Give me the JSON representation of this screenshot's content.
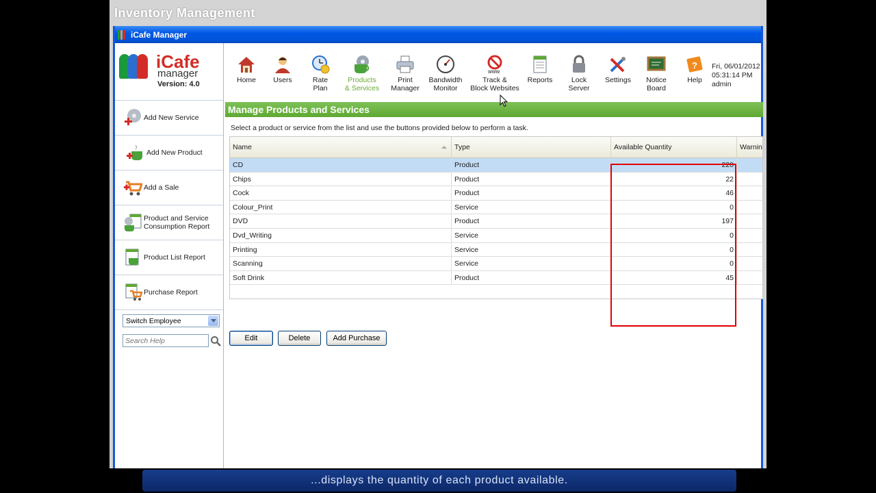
{
  "video": {
    "title": "Inventory Management",
    "caption": "...displays the quantity of each product available."
  },
  "window": {
    "title": "iCafe Manager"
  },
  "logo": {
    "brand": "iCafe",
    "sub": "manager",
    "version": "Version: 4.0"
  },
  "toolbar": {
    "items": [
      {
        "label": "Home",
        "icon": "house-icon"
      },
      {
        "label": "Users",
        "icon": "user-icon"
      },
      {
        "label": "Rate\nPlan",
        "icon": "clock-coin-icon"
      },
      {
        "label": "Products\n& Services",
        "icon": "cup-disc-icon",
        "active": true
      },
      {
        "label": "Print\nManager",
        "icon": "printer-icon"
      },
      {
        "label": "Bandwidth\nMonitor",
        "icon": "gauge-icon"
      },
      {
        "label": "Track &\nBlock Websites",
        "icon": "www-block-icon"
      },
      {
        "label": "Reports",
        "icon": "report-icon"
      },
      {
        "label": "Lock\nServer",
        "icon": "padlock-icon"
      },
      {
        "label": "Settings",
        "icon": "tools-icon"
      },
      {
        "label": "Notice\nBoard",
        "icon": "notice-board-icon"
      },
      {
        "label": "Help",
        "icon": "help-book-icon"
      }
    ],
    "date": "Fri, 06/01/2012",
    "time": "05:31:14 PM",
    "user": "admin"
  },
  "sidebar": {
    "items": [
      {
        "label": "Add New Service",
        "icon": "add-service-icon"
      },
      {
        "label": "Add New Product",
        "icon": "add-product-icon"
      },
      {
        "label": "Add a Sale",
        "icon": "cart-icon"
      },
      {
        "label": "Product and Service\nConsumption Report",
        "icon": "consumption-report-icon"
      },
      {
        "label": "Product List Report",
        "icon": "product-list-report-icon"
      },
      {
        "label": "Purchase Report",
        "icon": "purchase-report-icon"
      }
    ],
    "switch_employee": "Switch Employee",
    "search_placeholder": "Search Help"
  },
  "main": {
    "title": "Manage Products and Services",
    "instruction": "Select a product or service from the list and use the buttons provided below to perform a task.",
    "columns": [
      "Name",
      "Type",
      "Available Quantity",
      "Warnin"
    ],
    "rows": [
      {
        "name": "CD",
        "type": "Product",
        "qty": "220",
        "warn": ""
      },
      {
        "name": "Chips",
        "type": "Product",
        "qty": "22",
        "warn": ""
      },
      {
        "name": "Cock",
        "type": "Product",
        "qty": "46",
        "warn": ""
      },
      {
        "name": "Colour_Print",
        "type": "Service",
        "qty": "0",
        "warn": ""
      },
      {
        "name": "DVD",
        "type": "Product",
        "qty": "197",
        "warn": ""
      },
      {
        "name": "Dvd_Writing",
        "type": "Service",
        "qty": "0",
        "warn": ""
      },
      {
        "name": "Printing",
        "type": "Service",
        "qty": "0",
        "warn": ""
      },
      {
        "name": "Scanning",
        "type": "Service",
        "qty": "0",
        "warn": ""
      },
      {
        "name": "Soft Drink",
        "type": "Product",
        "qty": "45",
        "warn": ""
      }
    ],
    "selected_row": 0,
    "buttons": {
      "edit": "Edit",
      "delete": "Delete",
      "add_purchase": "Add Purchase"
    }
  },
  "colors": {
    "titlebar": "#0058e6",
    "header_green": "#6ab23e",
    "selection": "#c3dcf6",
    "highlight_box": "#e00000",
    "caption_bg": "#14367d"
  }
}
